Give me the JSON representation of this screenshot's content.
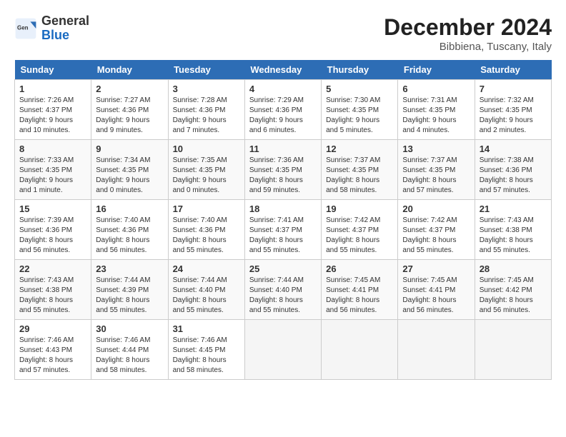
{
  "header": {
    "logo_text_general": "General",
    "logo_text_blue": "Blue",
    "month_year": "December 2024",
    "location": "Bibbiena, Tuscany, Italy"
  },
  "days_of_week": [
    "Sunday",
    "Monday",
    "Tuesday",
    "Wednesday",
    "Thursday",
    "Friday",
    "Saturday"
  ],
  "weeks": [
    [
      {
        "day": "1",
        "sunrise": "7:26 AM",
        "sunset": "4:37 PM",
        "daylight": "9 hours and 10 minutes."
      },
      {
        "day": "2",
        "sunrise": "7:27 AM",
        "sunset": "4:36 PM",
        "daylight": "9 hours and 9 minutes."
      },
      {
        "day": "3",
        "sunrise": "7:28 AM",
        "sunset": "4:36 PM",
        "daylight": "9 hours and 7 minutes."
      },
      {
        "day": "4",
        "sunrise": "7:29 AM",
        "sunset": "4:36 PM",
        "daylight": "9 hours and 6 minutes."
      },
      {
        "day": "5",
        "sunrise": "7:30 AM",
        "sunset": "4:35 PM",
        "daylight": "9 hours and 5 minutes."
      },
      {
        "day": "6",
        "sunrise": "7:31 AM",
        "sunset": "4:35 PM",
        "daylight": "9 hours and 4 minutes."
      },
      {
        "day": "7",
        "sunrise": "7:32 AM",
        "sunset": "4:35 PM",
        "daylight": "9 hours and 2 minutes."
      }
    ],
    [
      {
        "day": "8",
        "sunrise": "7:33 AM",
        "sunset": "4:35 PM",
        "daylight": "9 hours and 1 minute."
      },
      {
        "day": "9",
        "sunrise": "7:34 AM",
        "sunset": "4:35 PM",
        "daylight": "9 hours and 0 minutes."
      },
      {
        "day": "10",
        "sunrise": "7:35 AM",
        "sunset": "4:35 PM",
        "daylight": "9 hours and 0 minutes."
      },
      {
        "day": "11",
        "sunrise": "7:36 AM",
        "sunset": "4:35 PM",
        "daylight": "8 hours and 59 minutes."
      },
      {
        "day": "12",
        "sunrise": "7:37 AM",
        "sunset": "4:35 PM",
        "daylight": "8 hours and 58 minutes."
      },
      {
        "day": "13",
        "sunrise": "7:37 AM",
        "sunset": "4:35 PM",
        "daylight": "8 hours and 57 minutes."
      },
      {
        "day": "14",
        "sunrise": "7:38 AM",
        "sunset": "4:36 PM",
        "daylight": "8 hours and 57 minutes."
      }
    ],
    [
      {
        "day": "15",
        "sunrise": "7:39 AM",
        "sunset": "4:36 PM",
        "daylight": "8 hours and 56 minutes."
      },
      {
        "day": "16",
        "sunrise": "7:40 AM",
        "sunset": "4:36 PM",
        "daylight": "8 hours and 56 minutes."
      },
      {
        "day": "17",
        "sunrise": "7:40 AM",
        "sunset": "4:36 PM",
        "daylight": "8 hours and 55 minutes."
      },
      {
        "day": "18",
        "sunrise": "7:41 AM",
        "sunset": "4:37 PM",
        "daylight": "8 hours and 55 minutes."
      },
      {
        "day": "19",
        "sunrise": "7:42 AM",
        "sunset": "4:37 PM",
        "daylight": "8 hours and 55 minutes."
      },
      {
        "day": "20",
        "sunrise": "7:42 AM",
        "sunset": "4:37 PM",
        "daylight": "8 hours and 55 minutes."
      },
      {
        "day": "21",
        "sunrise": "7:43 AM",
        "sunset": "4:38 PM",
        "daylight": "8 hours and 55 minutes."
      }
    ],
    [
      {
        "day": "22",
        "sunrise": "7:43 AM",
        "sunset": "4:38 PM",
        "daylight": "8 hours and 55 minutes."
      },
      {
        "day": "23",
        "sunrise": "7:44 AM",
        "sunset": "4:39 PM",
        "daylight": "8 hours and 55 minutes."
      },
      {
        "day": "24",
        "sunrise": "7:44 AM",
        "sunset": "4:40 PM",
        "daylight": "8 hours and 55 minutes."
      },
      {
        "day": "25",
        "sunrise": "7:44 AM",
        "sunset": "4:40 PM",
        "daylight": "8 hours and 55 minutes."
      },
      {
        "day": "26",
        "sunrise": "7:45 AM",
        "sunset": "4:41 PM",
        "daylight": "8 hours and 56 minutes."
      },
      {
        "day": "27",
        "sunrise": "7:45 AM",
        "sunset": "4:41 PM",
        "daylight": "8 hours and 56 minutes."
      },
      {
        "day": "28",
        "sunrise": "7:45 AM",
        "sunset": "4:42 PM",
        "daylight": "8 hours and 56 minutes."
      }
    ],
    [
      {
        "day": "29",
        "sunrise": "7:46 AM",
        "sunset": "4:43 PM",
        "daylight": "8 hours and 57 minutes."
      },
      {
        "day": "30",
        "sunrise": "7:46 AM",
        "sunset": "4:44 PM",
        "daylight": "8 hours and 58 minutes."
      },
      {
        "day": "31",
        "sunrise": "7:46 AM",
        "sunset": "4:45 PM",
        "daylight": "8 hours and 58 minutes."
      },
      null,
      null,
      null,
      null
    ]
  ]
}
